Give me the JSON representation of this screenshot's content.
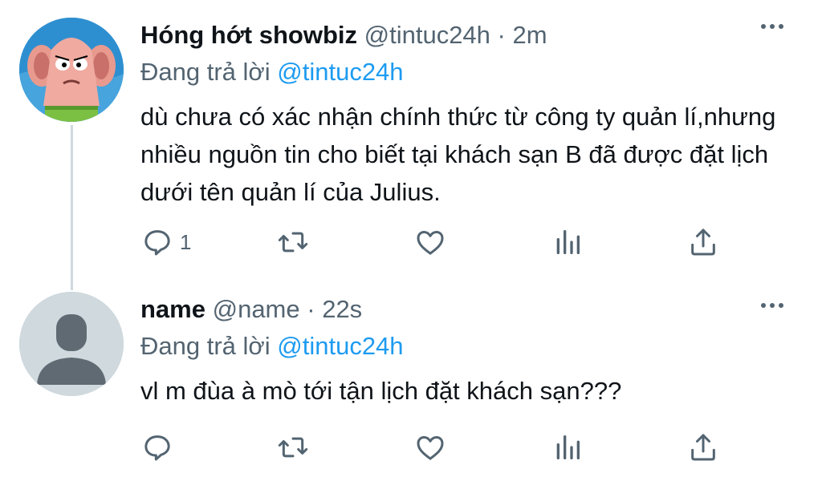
{
  "tweets": [
    {
      "display_name": "Hóng hớt showbiz",
      "handle": "@tintuc24h",
      "separator": "·",
      "time": "2m",
      "reply_prefix": "Đang trả lời",
      "reply_handle": "@tintuc24h",
      "text": "dù chưa có xác nhận chính thức từ công ty quản lí,nhưng nhiều nguồn tin cho biết tại khách sạn B đã được đặt lịch dưới tên quản lí của Julius.",
      "reply_count": "1",
      "avatar": "cartoon-character-avatar"
    },
    {
      "display_name": "name",
      "handle": "@name",
      "separator": "·",
      "time": "22s",
      "reply_prefix": "Đang trả lời",
      "reply_handle": "@tintuc24h",
      "text": "vl m đùa à mò tới tận lịch đặt khách sạn???",
      "reply_count": "",
      "avatar": "default-avatar"
    }
  ],
  "icons": [
    "reply-icon",
    "retweet-icon",
    "like-icon",
    "analytics-icon",
    "share-icon",
    "more-icon"
  ],
  "colors": {
    "link": "#1d9bf0",
    "secondary": "#536471",
    "text": "#0f1419",
    "thread_line": "#cfd9de"
  }
}
